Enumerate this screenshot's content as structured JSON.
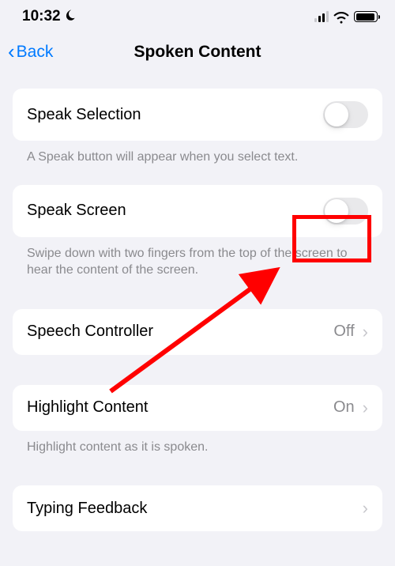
{
  "status": {
    "time": "10:32"
  },
  "nav": {
    "back": "Back",
    "title": "Spoken Content"
  },
  "cells": {
    "speakSelection": {
      "label": "Speak Selection",
      "footer": "A Speak button will appear when you select text."
    },
    "speakScreen": {
      "label": "Speak Screen",
      "footer": "Swipe down with two fingers from the top of the screen to hear the content of the screen."
    },
    "speechController": {
      "label": "Speech Controller",
      "value": "Off"
    },
    "highlightContent": {
      "label": "Highlight Content",
      "value": "On",
      "footer": "Highlight content as it is spoken."
    },
    "typingFeedback": {
      "label": "Typing Feedback"
    }
  }
}
